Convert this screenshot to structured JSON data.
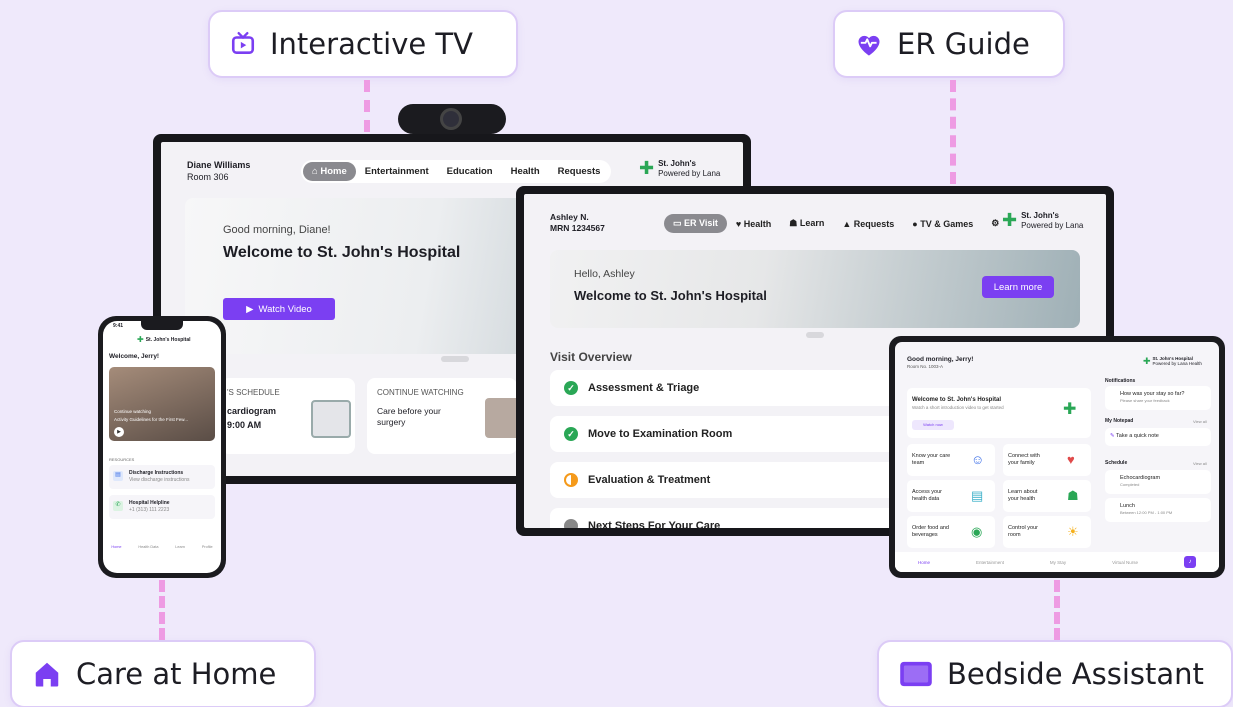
{
  "labels": {
    "tv": "Interactive TV",
    "er": "ER Guide",
    "home": "Care at Home",
    "bedside": "Bedside Assistant"
  },
  "tv": {
    "patient_name": "Diane Williams",
    "room": "Room 306",
    "nav": [
      "Home",
      "Entertainment",
      "Education",
      "Health",
      "Requests"
    ],
    "hospital": "St. John's",
    "powered": "Powered by Lana",
    "greeting": "Good morning, Diane!",
    "welcome": "Welcome to St. John's Hospital",
    "watch_btn": "Watch Video",
    "schedule_title": "'S SCHEDULE",
    "schedule_item": "cardiogram",
    "schedule_time": "9:00 AM",
    "continue_title": "CONTINUE WATCHING",
    "continue_item": "Care before your surgery"
  },
  "er": {
    "patient_name": "Ashley N.",
    "mrn": "MRN 1234567",
    "nav": [
      "ER Visit",
      "Health",
      "Learn",
      "Requests",
      "TV & Games"
    ],
    "hospital": "St. John's",
    "powered": "Powered by Lana",
    "greeting": "Hello, Ashley",
    "welcome": "Welcome to St. John's Hospital",
    "learn_btn": "Learn more",
    "overview_title": "Visit Overview",
    "steps": [
      "Assessment & Triage",
      "Move to Examination Room",
      "Evaluation & Treatment",
      "Next Steps For Your Care"
    ]
  },
  "phone": {
    "time": "9:41",
    "hospital": "St. John's Hospital",
    "welcome": "Welcome, Jerry!",
    "video_caption": "Continue watching",
    "video_title": "Activity Guidelines for the First Few...",
    "resources_label": "RESOURCES",
    "res1_title": "Discharge Instructions",
    "res1_sub": "View discharge instructions",
    "res2_title": "Hospital Helpline",
    "res2_sub": "+1 (313) 111 2223",
    "tabs": [
      "Home",
      "Health Data",
      "Learn",
      "Profile"
    ]
  },
  "tablet": {
    "greeting": "Good morning, Jerry!",
    "room": "Room No. 1003-A",
    "hospital": "St. John's Hospital",
    "powered": "Powered by Lana Health",
    "welcome_title": "Welcome to St. John's Hospital",
    "welcome_sub": "Watch a short introduction video to get started",
    "watch_now": "Watch now",
    "tiles": [
      "Know your care team",
      "Connect with your family",
      "Access your health data",
      "Learn about your health",
      "Order food and beverages",
      "Control your room"
    ],
    "notifications_label": "Notifications",
    "notif_title": "How was your stay so far?",
    "notif_sub": "Please share your feedback",
    "notepad_label": "My Notepad",
    "view_all": "View all",
    "notepad_item": "Take a quick note",
    "schedule_label": "Schedule",
    "sched1": "Echocardiogram",
    "sched1_sub": "Completed",
    "sched2": "Lunch",
    "sched2_sub": "Between 12:00 PM - 1:00 PM",
    "tabs": [
      "Home",
      "Entertainment",
      "My Stay",
      "Virtual Nurse"
    ]
  },
  "colors": {
    "accent": "#7b3ff2",
    "dash": "#ee9be3",
    "bg": "#efe9fb",
    "green": "#2aa756"
  }
}
